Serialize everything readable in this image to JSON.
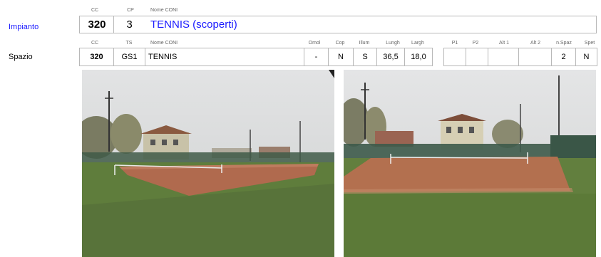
{
  "impianto": {
    "row_label": "Impianto",
    "headers": {
      "cc": "CC",
      "cp": "CP",
      "nome": "Nome CONI"
    },
    "cc": "320",
    "cp": "3",
    "nome": "TENNIS (scoperti)"
  },
  "spazio": {
    "row_label": "Spazio",
    "headers": {
      "cc": "CC",
      "ts": "TS",
      "nome": "Nome CONI",
      "omol": "Omol",
      "cop": "Cop",
      "illum": "Illum",
      "lungh": "Lungh",
      "largh": "Largh",
      "p1": "P1",
      "p2": "P2",
      "alt1": "Alt 1",
      "alt2": "Alt 2",
      "nspaz": "n.Spaz",
      "spet": "Spet"
    },
    "values": {
      "cc": "320",
      "ts": "GS1",
      "nome": "TENNIS",
      "omol": "-",
      "cop": "N",
      "illum": "S",
      "lungh": "36,5",
      "largh": "18,0",
      "p1": "",
      "p2": "",
      "alt1": "",
      "alt2": "",
      "nspaz": "2",
      "spet": "N"
    }
  },
  "colors": {
    "link_blue": "#1a1aff",
    "border": "#b8b8b8",
    "header_text": "#666666"
  }
}
